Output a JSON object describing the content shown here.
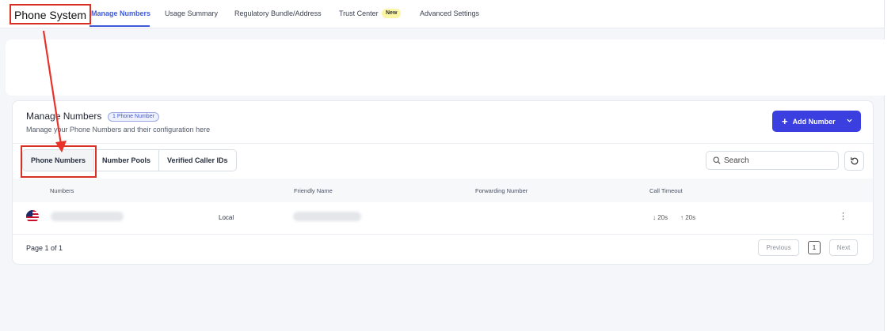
{
  "app": {
    "title": "Phone System"
  },
  "nav": {
    "tabs": [
      {
        "label": "Manage Numbers",
        "active": true
      },
      {
        "label": "Usage Summary"
      },
      {
        "label": "Regulatory Bundle/Address"
      },
      {
        "label": "Trust Center"
      },
      {
        "label": "Advanced Settings"
      }
    ],
    "new_badge": "New"
  },
  "card": {
    "title": "Manage Numbers",
    "count_badge": "1 Phone Number",
    "subtitle": "Manage your Phone Numbers and their configuration here",
    "add_button": "Add Number"
  },
  "tabs": [
    "Phone Numbers",
    "Number Pools",
    "Verified Caller IDs"
  ],
  "search": {
    "placeholder": "Search"
  },
  "table": {
    "headers": [
      "Numbers",
      "Friendly Name",
      "Forwarding Number",
      "Call Timeout"
    ],
    "rows": [
      {
        "type": "Local",
        "timeout_in": "↓ 20s",
        "timeout_out": "↑ 20s"
      }
    ]
  },
  "pagination": {
    "page_info": "Page 1 of 1",
    "previous": "Previous",
    "current": "1",
    "next": "Next"
  },
  "colors": {
    "accent": "#3f5ad8",
    "primary_button": "#3b3fe0",
    "annotation": "#d93025",
    "new_badge": "#fbf5a6"
  },
  "icons": [
    "plus-icon",
    "chevron-down-icon",
    "search-icon",
    "refresh-icon",
    "us-flag-icon",
    "kebab-menu-icon"
  ]
}
